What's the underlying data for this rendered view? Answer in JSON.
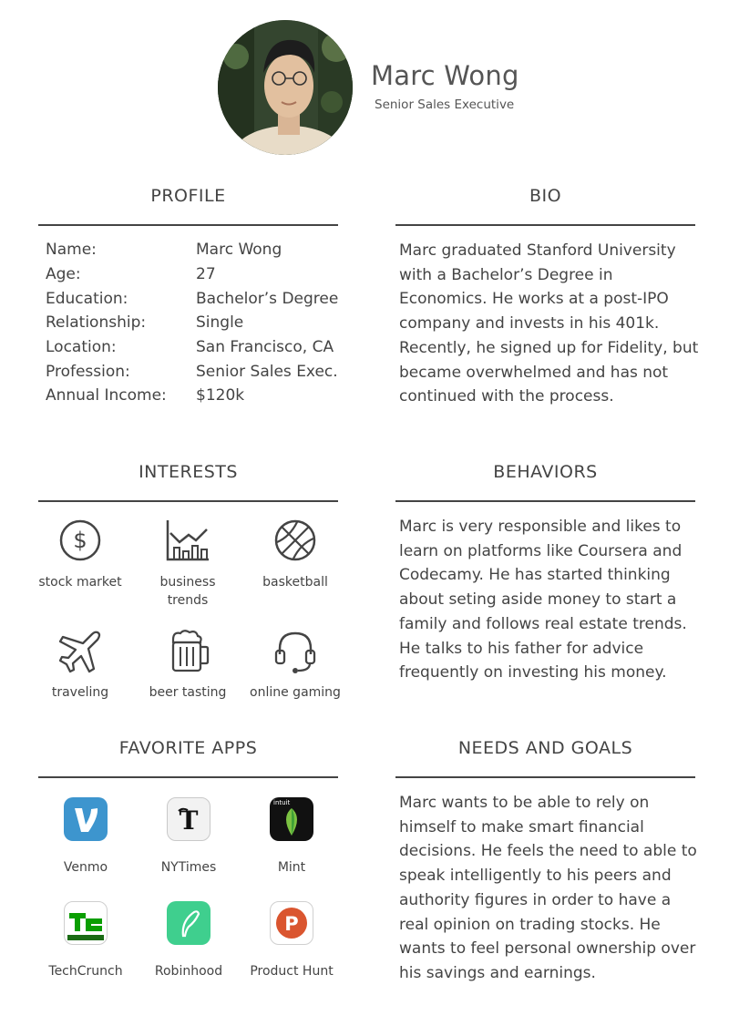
{
  "header": {
    "name": "Marc Wong",
    "title": "Senior Sales Executive"
  },
  "profile": {
    "heading": "PROFILE",
    "rows": [
      {
        "label": "Name:",
        "value": "Marc Wong"
      },
      {
        "label": "Age:",
        "value": "27"
      },
      {
        "label": "Education:",
        "value": "Bachelor’s Degree"
      },
      {
        "label": "Relationship:",
        "value": "Single"
      },
      {
        "label": "Location:",
        "value": "San Francisco, CA"
      },
      {
        "label": "Profession:",
        "value": "Senior Sales Exec."
      },
      {
        "label": "Annual Income:",
        "value": "$120k"
      }
    ]
  },
  "bio": {
    "heading": "BIO",
    "text": "Marc graduated Stanford University with a Bachelor’s Degree in Economics. He works at a post-IPO company and invests in his 401k. Recently, he signed up for Fidelity, but became overwhelmed and has not continued with the process."
  },
  "interests": {
    "heading": "INTERESTS",
    "items": [
      {
        "label": "stock market",
        "icon": "dollar-circle-icon"
      },
      {
        "label": "business trends",
        "icon": "bar-chart-icon"
      },
      {
        "label": "basketball",
        "icon": "basketball-icon"
      },
      {
        "label": "traveling",
        "icon": "airplane-icon"
      },
      {
        "label": "beer tasting",
        "icon": "beer-mug-icon"
      },
      {
        "label": "online gaming",
        "icon": "headset-icon"
      }
    ]
  },
  "behaviors": {
    "heading": "BEHAVIORS",
    "text": "Marc is very responsible and likes to learn on platforms like Coursera and Codecamy. He has started thinking about seting aside money to start a family and follows real estate trends. He talks to his father for advice frequently on investing his money."
  },
  "apps": {
    "heading": "FAVORITE APPS",
    "items": [
      {
        "label": "Venmo",
        "icon": "venmo-icon",
        "color": "#3d95ce"
      },
      {
        "label": "NYTimes",
        "icon": "nytimes-icon",
        "color": "#f2f2f2"
      },
      {
        "label": "Mint",
        "icon": "mint-icon",
        "color": "#111111",
        "badge": "intuit"
      },
      {
        "label": "TechCrunch",
        "icon": "techcrunch-icon",
        "color": "#0a9e01"
      },
      {
        "label": "Robinhood",
        "icon": "robinhood-icon",
        "color": "#3fcf8e"
      },
      {
        "label": "Product Hunt",
        "icon": "product-hunt-icon",
        "color": "#da552f"
      }
    ]
  },
  "needs": {
    "heading": "NEEDS AND GOALS",
    "text": "Marc wants to be able to rely on himself to make smart financial decisions. He feels the need to able to speak intelligently to his peers and authority figures in order to have a real opinion on trading stocks. He wants to feel personal ownership over his savings and earnings."
  }
}
